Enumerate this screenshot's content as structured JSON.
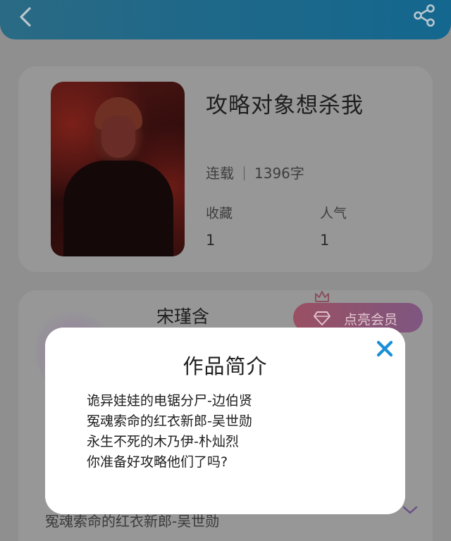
{
  "header": {
    "back_icon": "chevron-left-icon",
    "share_icon": "share-icon"
  },
  "book": {
    "title": "攻略对象想杀我",
    "status": "连载",
    "word_count": "1396字",
    "stats": [
      {
        "label": "收藏",
        "value": "1"
      },
      {
        "label": "人气",
        "value": "1"
      }
    ]
  },
  "author": {
    "name": "宋瑾含",
    "vip_label": "点亮会员"
  },
  "background_intro_line": "冤魂索命的红衣新郎-吴世勋",
  "modal": {
    "title": "作品简介",
    "close_icon": "close-icon",
    "intro_lines": [
      "诡异娃娃的电锯分尸-边伯贤",
      "冤魂索命的红衣新郎-吴世勋",
      "永生不死的木乃伊-朴灿烈",
      "你准备好攻略他们了吗?"
    ]
  },
  "colors": {
    "header_gradient_start": "#2a6a84",
    "header_gradient_end": "#14678f",
    "overlay_gray": "#8f8f8f",
    "close_icon": "#1a8fd6",
    "vip_gradient_start": "#9a5063",
    "vip_gradient_end": "#7e5680"
  }
}
